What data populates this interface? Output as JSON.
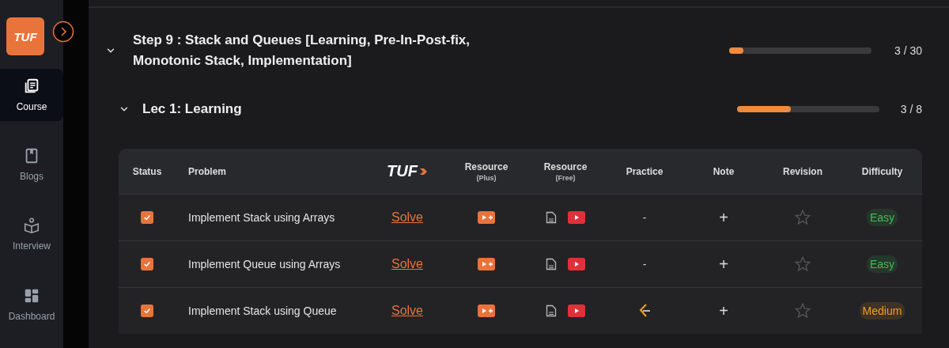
{
  "sidebar": {
    "logo": "TUF",
    "items": [
      {
        "label": "Course",
        "selected": true,
        "kind": "course"
      },
      {
        "label": "Blogs",
        "selected": false,
        "kind": "blogs"
      },
      {
        "label": "Interview",
        "selected": false,
        "kind": "interview"
      },
      {
        "label": "Dashboard",
        "selected": false,
        "kind": "dashboard"
      }
    ]
  },
  "step": {
    "title": "Step 9 : Stack and Queues [Learning, Pre-In-Post-fix, Monotonic Stack, Implementation]",
    "expanded": true,
    "level": 0.1,
    "count": "3 / 30"
  },
  "lecture": {
    "title": "Lec 1: Learning",
    "expanded": true,
    "level": 0.375,
    "count": "3 / 8"
  },
  "table": {
    "columns": [
      {
        "label": "Status"
      },
      {
        "label": "Problem"
      },
      {
        "label": "TUF",
        "kind": "logo"
      },
      {
        "label": "Resource",
        "sub": "(Plus)"
      },
      {
        "label": "Resource",
        "sub": "(Free)"
      },
      {
        "label": "Practice"
      },
      {
        "label": "Note"
      },
      {
        "label": "Revision"
      },
      {
        "label": "Difficulty"
      }
    ],
    "rows": [
      {
        "checked": true,
        "problem": "Implement Stack using Arrays",
        "solve": "Solve",
        "practice": {
          "kind": "dash",
          "text": "-"
        },
        "note": "+",
        "starred": false,
        "difficulty": {
          "text": "Easy",
          "color": "#3fbf55"
        }
      },
      {
        "checked": true,
        "problem": "Implement Queue using Arrays",
        "solve": "Solve",
        "practice": {
          "kind": "dash",
          "text": "-"
        },
        "note": "+",
        "starred": false,
        "difficulty": {
          "text": "Easy",
          "color": "#3fbf55"
        }
      },
      {
        "checked": true,
        "problem": "Implement Stack using Queue",
        "solve": "Solve",
        "practice": {
          "kind": "icon"
        },
        "note": "+",
        "starred": false,
        "difficulty": {
          "text": "Medium",
          "color": "#f0a020"
        }
      }
    ]
  }
}
